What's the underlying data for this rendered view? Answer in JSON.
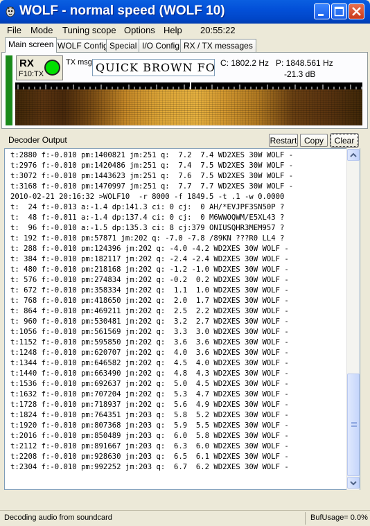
{
  "window": {
    "title": "WOLF - normal speed (WOLF 10)"
  },
  "menu": {
    "items": [
      "File",
      "Mode",
      "Tuning scope",
      "Options",
      "Help"
    ],
    "clock": "20:55:22"
  },
  "tabs": [
    "Main screen",
    "WOLF Config",
    "Special",
    "I/O Config",
    "RX / TX messages"
  ],
  "status_panel": {
    "mode": "RX",
    "mode_sub": "F10:TX",
    "tx_msg_label": "TX msg",
    "tx_msg_value": "QUICK BROWN FOX",
    "freq_c": "C: 1802.2 Hz",
    "freq_p": "P: 1848.561 Hz",
    "level": "-21.3 dB",
    "light_color": "#00e000"
  },
  "decoder": {
    "label": "Decoder Output",
    "buttons": [
      "Restart",
      "Copy",
      "Clear"
    ],
    "lines": [
      "t:2880 f:-0.010 pm:1400821 jm:251 q:  7.2  7.4 WD2XES 30W WOLF -",
      "t:2976 f:-0.010 pm:1420486 jm:251 q:  7.4  7.5 WD2XES 30W WOLF -",
      "t:3072 f:-0.010 pm:1443623 jm:251 q:  7.6  7.5 WD2XES 30W WOLF -",
      "t:3168 f:-0.010 pm:1470997 jm:251 q:  7.7  7.7 WD2XES 30W WOLF -",
      "2010-02-21 20:16:32 >WOLF10  -r 8000 -f 1849.5 -t .1 -w 0.0000",
      "t:  24 f:-0.013 a:-1.4 dp:141.3 ci: 0 cj:  0 AH/*EVJPF3SN50P ?",
      "t:  48 f:-0.011 a:-1.4 dp:137.4 ci: 0 cj:  0 M6WWOQWM/E5XL43 ?",
      "t:  96 f:-0.010 a:-1.5 dp:135.3 ci: 8 cj:379 ONIUSQHR3MEM957 ?",
      "t: 192 f:-0.010 pm:57871 jm:202 q: -7.0 -7.8 /89KN ???R0 LL4 ?",
      "t: 288 f:-0.010 pm:124396 jm:202 q: -4.0 -4.2 WD2XES 30W WOLF -",
      "t: 384 f:-0.010 pm:182117 jm:202 q: -2.4 -2.4 WD2XES 30W WOLF -",
      "t: 480 f:-0.010 pm:218168 jm:202 q: -1.2 -1.0 WD2XES 30W WOLF -",
      "t: 576 f:-0.010 pm:274834 jm:202 q: -0.2  0.2 WD2XES 30W WOLF -",
      "t: 672 f:-0.010 pm:358334 jm:202 q:  1.1  1.0 WD2XES 30W WOLF -",
      "t: 768 f:-0.010 pm:418650 jm:202 q:  2.0  1.7 WD2XES 30W WOLF -",
      "t: 864 f:-0.010 pm:469211 jm:202 q:  2.5  2.2 WD2XES 30W WOLF -",
      "t: 960 f:-0.010 pm:530481 jm:202 q:  3.2  2.7 WD2XES 30W WOLF -",
      "t:1056 f:-0.010 pm:561569 jm:202 q:  3.3  3.0 WD2XES 30W WOLF -",
      "t:1152 f:-0.010 pm:595850 jm:202 q:  3.6  3.6 WD2XES 30W WOLF -",
      "t:1248 f:-0.010 pm:620707 jm:202 q:  4.0  3.6 WD2XES 30W WOLF -",
      "t:1344 f:-0.010 pm:646582 jm:202 q:  4.5  4.0 WD2XES 30W WOLF -",
      "t:1440 f:-0.010 pm:663490 jm:202 q:  4.8  4.3 WD2XES 30W WOLF -",
      "t:1536 f:-0.010 pm:692637 jm:202 q:  5.0  4.5 WD2XES 30W WOLF -",
      "t:1632 f:-0.010 pm:707204 jm:202 q:  5.3  4.7 WD2XES 30W WOLF -",
      "t:1728 f:-0.010 pm:718937 jm:202 q:  5.6  4.9 WD2XES 30W WOLF -",
      "t:1824 f:-0.010 pm:764351 jm:203 q:  5.8  5.2 WD2XES 30W WOLF -",
      "t:1920 f:-0.010 pm:807368 jm:203 q:  5.9  5.5 WD2XES 30W WOLF -",
      "t:2016 f:-0.010 pm:850489 jm:203 q:  6.0  5.8 WD2XES 30W WOLF -",
      "t:2112 f:-0.010 pm:891667 jm:203 q:  6.3  6.0 WD2XES 30W WOLF -",
      "t:2208 f:-0.010 pm:928630 jm:203 q:  6.5  6.1 WD2XES 30W WOLF -",
      "t:2304 f:-0.010 pm:992252 jm:203 q:  6.7  6.2 WD2XES 30W WOLF -"
    ]
  },
  "statusbar": {
    "left": "Decoding audio from soundcard",
    "right": "BufUsage= 0.0%"
  },
  "icons": {
    "app": "wolf-app-icon",
    "minimize": "minimize-icon",
    "maximize": "maximize-icon",
    "close": "close-icon",
    "scroll_up": "arrow-up-icon",
    "scroll_down": "arrow-down-icon"
  }
}
